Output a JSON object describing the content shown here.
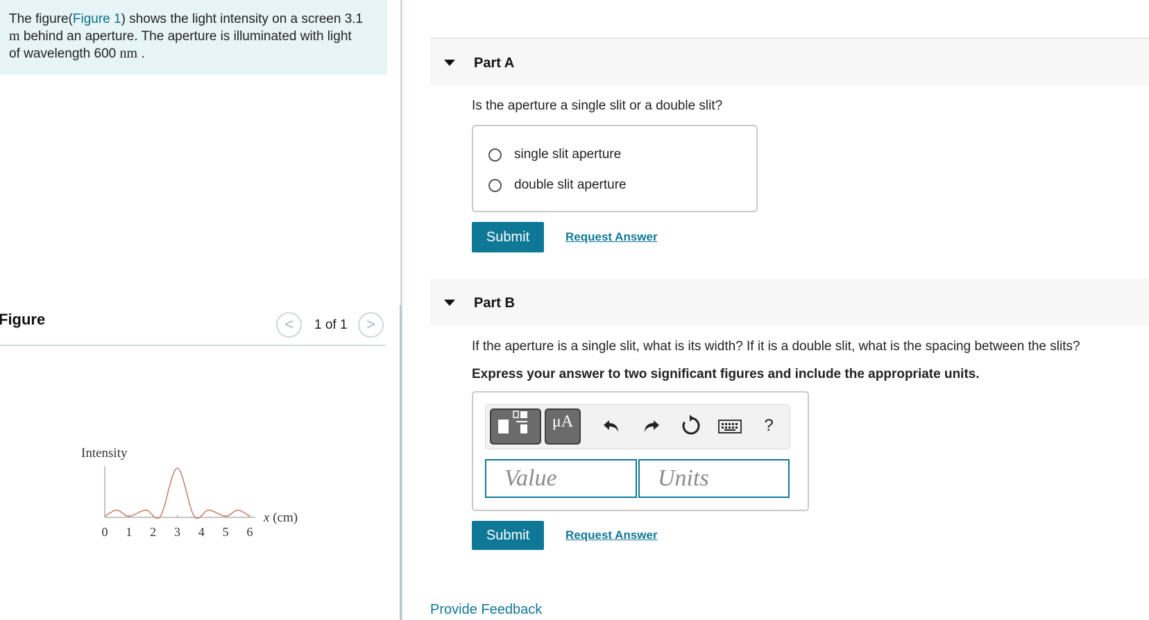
{
  "problem": {
    "text_before_link": "The figure(",
    "link_text": "Figure 1",
    "text_after_link": ") shows the light intensity on a screen 3.1",
    "line2_unit": "m",
    "line2_text": " behind an aperture. The aperture is illuminated with light",
    "line3_text": "of wavelength 600 ",
    "line3_unit": "nm",
    "line3_end": " ."
  },
  "figure": {
    "title": "Figure",
    "counter": "1 of 1",
    "prev_icon": "chevron-left-icon",
    "next_icon": "chevron-right-icon",
    "prev_glyph": "<",
    "next_glyph": ">",
    "ylabel": "Intensity",
    "xlabel": "x (cm)",
    "xlabel_var": "x",
    "xlabel_unit": " (cm)"
  },
  "chart_data": {
    "type": "line",
    "ylabel": "Intensity",
    "xlabel": "x (cm)",
    "ticks": [
      "0",
      "1",
      "2",
      "3",
      "4",
      "5",
      "6"
    ],
    "xlim": [
      0,
      6
    ],
    "x": [
      0,
      0.5,
      1.0,
      1.7,
      2.3,
      3.0,
      3.7,
      4.3,
      5.0,
      5.5,
      6.0
    ],
    "y": [
      0.02,
      0.14,
      0.02,
      0.14,
      0.02,
      0.96,
      0.02,
      0.14,
      0.02,
      0.14,
      0.02
    ],
    "line_color": "#c9826e"
  },
  "partA": {
    "title": "Part A",
    "question": "Is the aperture a single slit or a double slit?",
    "options": [
      "single slit aperture",
      "double slit aperture"
    ],
    "submit": "Submit",
    "request": "Request Answer"
  },
  "partB": {
    "title": "Part B",
    "question": "If the aperture is a single slit, what is its width? If it is a double slit, what is the spacing between the slits?",
    "instruction": "Express your answer to two significant figures and include the appropriate units.",
    "toolbar": {
      "units_label": "μA",
      "icons": [
        "templates-icon",
        "units-icon",
        "undo-icon",
        "redo-icon",
        "reset-icon",
        "keyboard-icon",
        "help-icon"
      ],
      "help_label": "?"
    },
    "value_placeholder": "Value",
    "units_placeholder": "Units",
    "submit": "Submit",
    "request": "Request Answer"
  },
  "footer": {
    "feedback": "Provide Feedback"
  },
  "colors": {
    "accent": "#0f7897",
    "problem_bg": "#e8f5f6",
    "part_header_bg": "#f7f7f7"
  }
}
